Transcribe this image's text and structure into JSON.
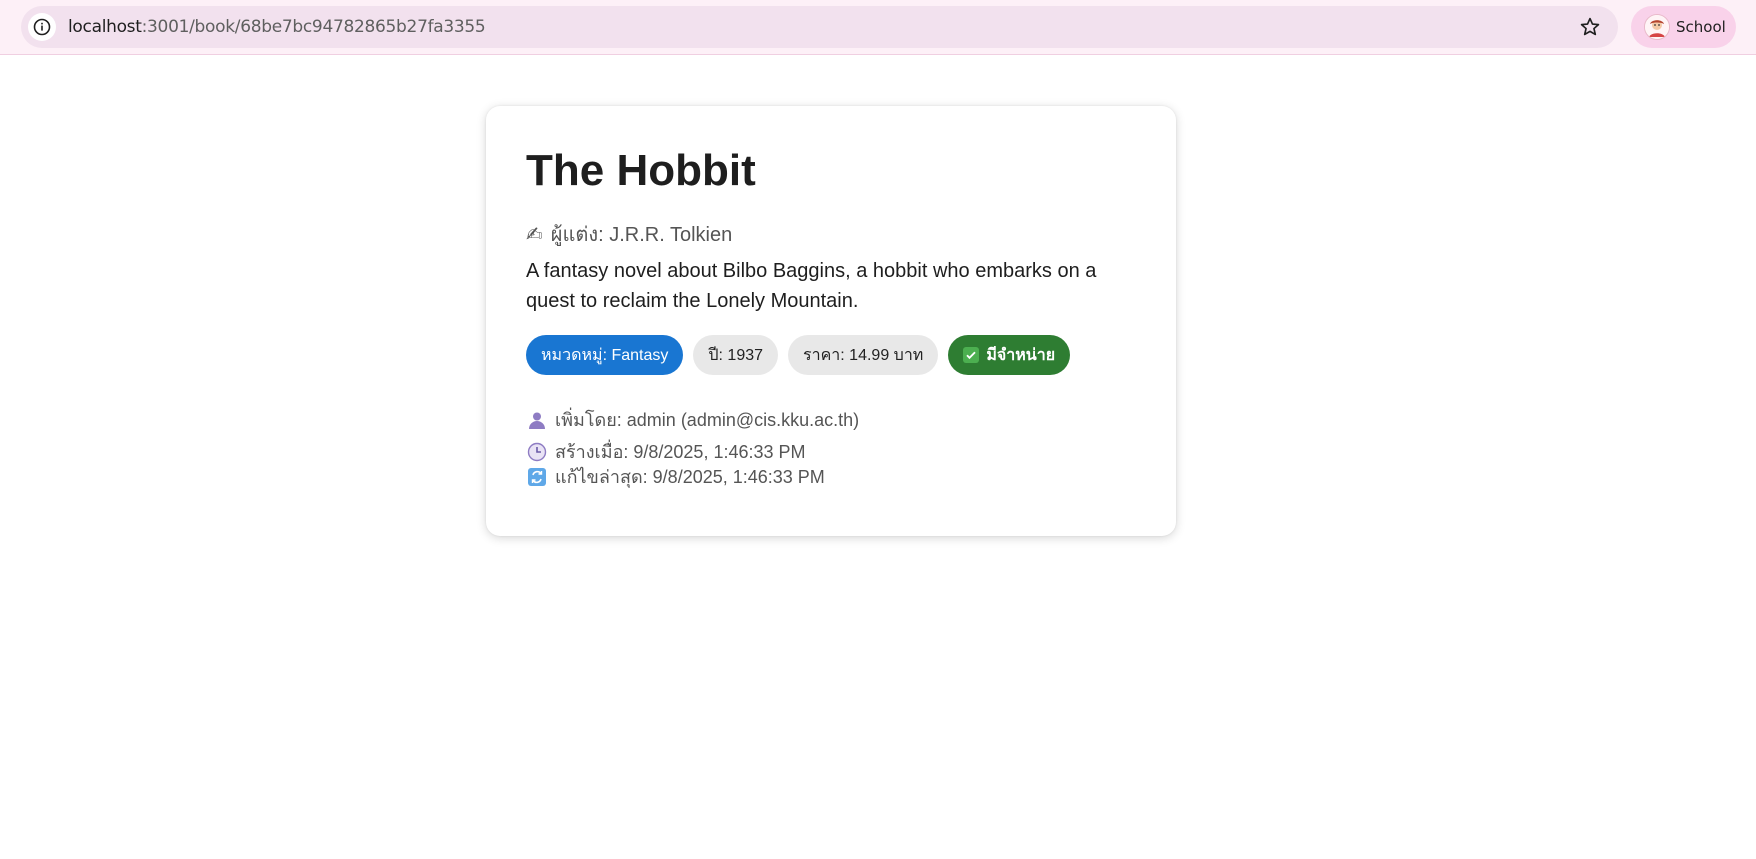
{
  "browser": {
    "url_host": "localhost",
    "url_path": ":3001/book/68be7bc94782865b27fa3355",
    "profile_name": "School"
  },
  "book": {
    "title": "The Hobbit",
    "author_label": "ผู้แต่ง: J.R.R. Tolkien",
    "description": "A fantasy novel about Bilbo Baggins, a hobbit who embarks on a quest to reclaim the Lonely Mountain.",
    "badges": {
      "category": "หมวดหมู่: Fantasy",
      "year": "ปี: 1937",
      "price": "ราคา: 14.99 บาท",
      "stock": "มีจำหน่าย"
    },
    "meta": {
      "added_by": "เพิ่มโดย: admin (admin@cis.kku.ac.th)",
      "created": "สร้างเมื่อ: 9/8/2025, 1:46:33 PM",
      "updated": "แก้ไขล่าสุด: 9/8/2025, 1:46:33 PM"
    }
  },
  "icons": {
    "author": "writing-hand-icon",
    "added_by": "user-icon",
    "created": "clock-icon",
    "updated": "refresh-icon",
    "stock": "check-mark-icon"
  },
  "colors": {
    "category_badge": "#1976d2",
    "stock_badge": "#2e7d32",
    "neutral_badge": "#e8e8e8"
  }
}
